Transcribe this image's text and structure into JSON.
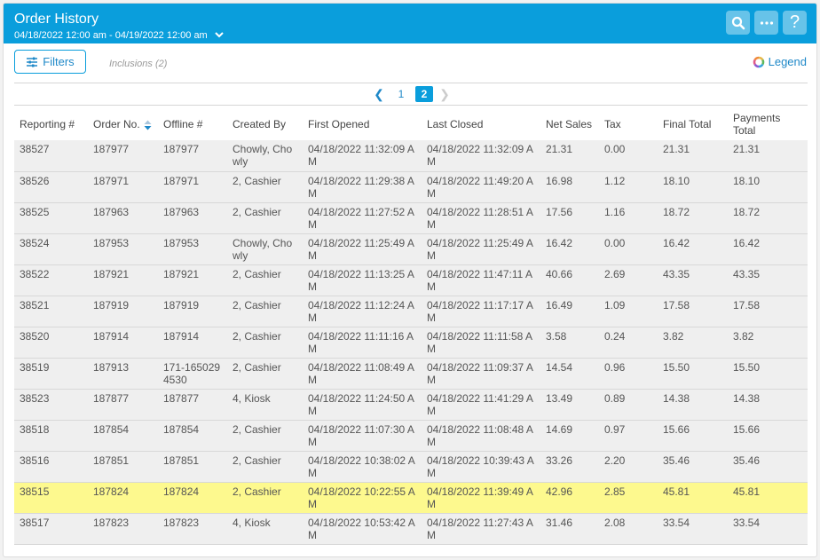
{
  "header": {
    "title": "Order History",
    "date_range": "04/18/2022 12:00 am - 04/19/2022 12:00 am",
    "buttons": {
      "search": "search-icon",
      "more": "more-icon",
      "help": "?"
    }
  },
  "toolbar": {
    "filters_label": "Filters",
    "inclusions_label": "Inclusions (2)",
    "legend_label": "Legend"
  },
  "pagination": {
    "pages": [
      "1",
      "2"
    ],
    "current": "2"
  },
  "colors": {
    "accent": "#0a9edc",
    "highlight_row": "#fdf98e",
    "row_bg": "#efefef"
  },
  "table": {
    "columns": [
      "Reporting #",
      "Order No.",
      "Offline #",
      "Created By",
      "First Opened",
      "Last Closed",
      "Net Sales",
      "Tax",
      "Final Total",
      "Payments Total"
    ],
    "sorted_column": "Order No.",
    "rows": [
      {
        "reporting": "38527",
        "order_no": "187977",
        "offline": "187977",
        "created_by": "Chowly, Chowly",
        "first_opened": "04/18/2022 11:32:09 AM",
        "last_closed": "04/18/2022 11:32:09 AM",
        "net_sales": "21.31",
        "tax": "0.00",
        "final_total": "21.31",
        "payments_total": "21.31",
        "highlight": false
      },
      {
        "reporting": "38526",
        "order_no": "187971",
        "offline": "187971",
        "created_by": "2, Cashier",
        "first_opened": "04/18/2022 11:29:38 AM",
        "last_closed": "04/18/2022 11:49:20 AM",
        "net_sales": "16.98",
        "tax": "1.12",
        "final_total": "18.10",
        "payments_total": "18.10",
        "highlight": false
      },
      {
        "reporting": "38525",
        "order_no": "187963",
        "offline": "187963",
        "created_by": "2, Cashier",
        "first_opened": "04/18/2022 11:27:52 AM",
        "last_closed": "04/18/2022 11:28:51 AM",
        "net_sales": "17.56",
        "tax": "1.16",
        "final_total": "18.72",
        "payments_total": "18.72",
        "highlight": false
      },
      {
        "reporting": "38524",
        "order_no": "187953",
        "offline": "187953",
        "created_by": "Chowly, Chowly",
        "first_opened": "04/18/2022 11:25:49 AM",
        "last_closed": "04/18/2022 11:25:49 AM",
        "net_sales": "16.42",
        "tax": "0.00",
        "final_total": "16.42",
        "payments_total": "16.42",
        "highlight": false
      },
      {
        "reporting": "38522",
        "order_no": "187921",
        "offline": "187921",
        "created_by": "2, Cashier",
        "first_opened": "04/18/2022 11:13:25 AM",
        "last_closed": "04/18/2022 11:47:11 AM",
        "net_sales": "40.66",
        "tax": "2.69",
        "final_total": "43.35",
        "payments_total": "43.35",
        "highlight": false
      },
      {
        "reporting": "38521",
        "order_no": "187919",
        "offline": "187919",
        "created_by": "2, Cashier",
        "first_opened": "04/18/2022 11:12:24 AM",
        "last_closed": "04/18/2022 11:17:17 AM",
        "net_sales": "16.49",
        "tax": "1.09",
        "final_total": "17.58",
        "payments_total": "17.58",
        "highlight": false
      },
      {
        "reporting": "38520",
        "order_no": "187914",
        "offline": "187914",
        "created_by": "2, Cashier",
        "first_opened": "04/18/2022 11:11:16 AM",
        "last_closed": "04/18/2022 11:11:58 AM",
        "net_sales": "3.58",
        "tax": "0.24",
        "final_total": "3.82",
        "payments_total": "3.82",
        "highlight": false
      },
      {
        "reporting": "38519",
        "order_no": "187913",
        "offline": "171-1650294530",
        "created_by": "2, Cashier",
        "first_opened": "04/18/2022 11:08:49 AM",
        "last_closed": "04/18/2022 11:09:37 AM",
        "net_sales": "14.54",
        "tax": "0.96",
        "final_total": "15.50",
        "payments_total": "15.50",
        "highlight": false
      },
      {
        "reporting": "38523",
        "order_no": "187877",
        "offline": "187877",
        "created_by": "4, Kiosk",
        "first_opened": "04/18/2022 11:24:50 AM",
        "last_closed": "04/18/2022 11:41:29 AM",
        "net_sales": "13.49",
        "tax": "0.89",
        "final_total": "14.38",
        "payments_total": "14.38",
        "highlight": false
      },
      {
        "reporting": "38518",
        "order_no": "187854",
        "offline": "187854",
        "created_by": "2, Cashier",
        "first_opened": "04/18/2022 11:07:30 AM",
        "last_closed": "04/18/2022 11:08:48 AM",
        "net_sales": "14.69",
        "tax": "0.97",
        "final_total": "15.66",
        "payments_total": "15.66",
        "highlight": false
      },
      {
        "reporting": "38516",
        "order_no": "187851",
        "offline": "187851",
        "created_by": "2, Cashier",
        "first_opened": "04/18/2022 10:38:02 AM",
        "last_closed": "04/18/2022 10:39:43 AM",
        "net_sales": "33.26",
        "tax": "2.20",
        "final_total": "35.46",
        "payments_total": "35.46",
        "highlight": false
      },
      {
        "reporting": "38515",
        "order_no": "187824",
        "offline": "187824",
        "created_by": "2, Cashier",
        "first_opened": "04/18/2022 10:22:55 AM",
        "last_closed": "04/18/2022 11:39:49 AM",
        "net_sales": "42.96",
        "tax": "2.85",
        "final_total": "45.81",
        "payments_total": "45.81",
        "highlight": true
      },
      {
        "reporting": "38517",
        "order_no": "187823",
        "offline": "187823",
        "created_by": "4, Kiosk",
        "first_opened": "04/18/2022 10:53:42 AM",
        "last_closed": "04/18/2022 11:27:43 AM",
        "net_sales": "31.46",
        "tax": "2.08",
        "final_total": "33.54",
        "payments_total": "33.54",
        "highlight": false
      }
    ]
  }
}
